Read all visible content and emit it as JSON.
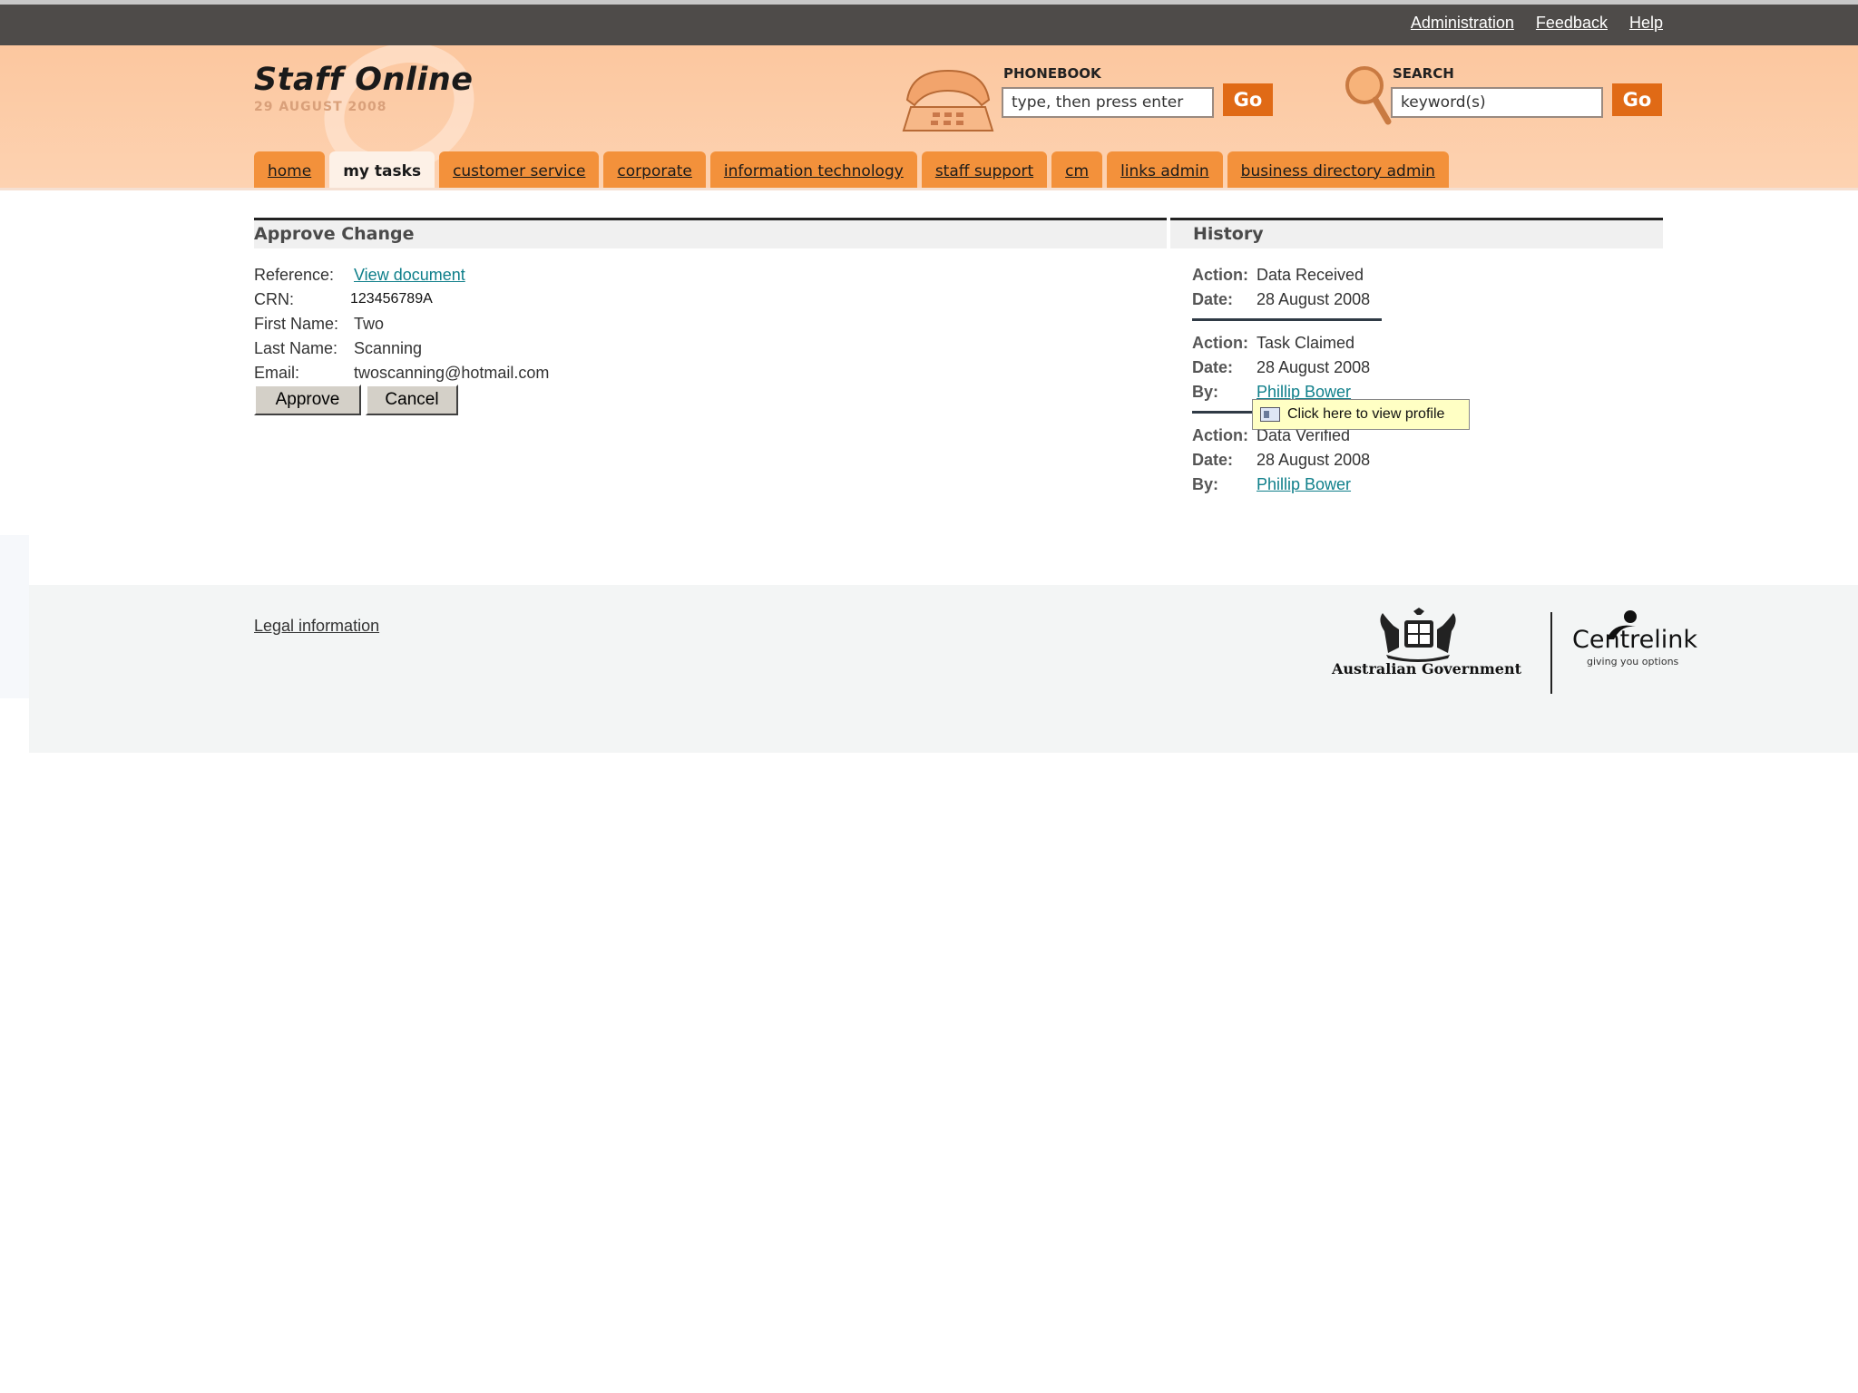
{
  "topbar": {
    "links": [
      "Administration",
      "Feedback",
      "Help"
    ]
  },
  "brand": {
    "title": "Staff Online",
    "date": "29 AUGUST 2008"
  },
  "phonebook": {
    "label": "PHONEBOOK",
    "value": "type, then press enter",
    "go": "Go"
  },
  "search": {
    "label": "SEARCH",
    "value": "keyword(s)",
    "go": "Go"
  },
  "tabs": [
    {
      "label": "home",
      "active": false
    },
    {
      "label": "my tasks",
      "active": true
    },
    {
      "label": "customer service",
      "active": false
    },
    {
      "label": "corporate",
      "active": false
    },
    {
      "label": "information technology",
      "active": false
    },
    {
      "label": "staff support",
      "active": false
    },
    {
      "label": "cm",
      "active": false
    },
    {
      "label": "links admin",
      "active": false
    },
    {
      "label": "business directory admin",
      "active": false
    }
  ],
  "approve": {
    "title": "Approve Change",
    "reference_label": "Reference:",
    "reference_link": "View document",
    "crn_label": "CRN:",
    "crn": "123456789A",
    "first_label": "First Name:",
    "first": "Two",
    "last_label": "Last Name:",
    "last": "Scanning",
    "email_label": "Email:",
    "email": "twoscanning@hotmail.com",
    "approve_btn": "Approve",
    "cancel_btn": "Cancel"
  },
  "history": {
    "title": "History",
    "action_label": "Action:",
    "date_label": "Date:",
    "by_label": "By:",
    "entries": [
      {
        "action": "Data Received",
        "date": "28 August 2008"
      },
      {
        "action": "Task Claimed",
        "date": "28 August 2008",
        "by": "Phillip Bower"
      },
      {
        "action": "Data Verified",
        "date": "28 August 2008",
        "by": "Phillip Bower"
      }
    ]
  },
  "tooltip": {
    "text": "Click here to view profile"
  },
  "footer": {
    "legal": "Legal information",
    "govt": "Australian Government",
    "brand": "Centrelink",
    "tagline": "giving you options"
  },
  "colors": {
    "accent": "#e06a16",
    "tab": "#f3913b",
    "header": "#fcc79f",
    "link": "#0f7f8a"
  },
  "icons": [
    "phone-icon",
    "magnifier-icon",
    "profile-card-icon",
    "coat-of-arms-icon",
    "centrelink-logo-icon"
  ]
}
